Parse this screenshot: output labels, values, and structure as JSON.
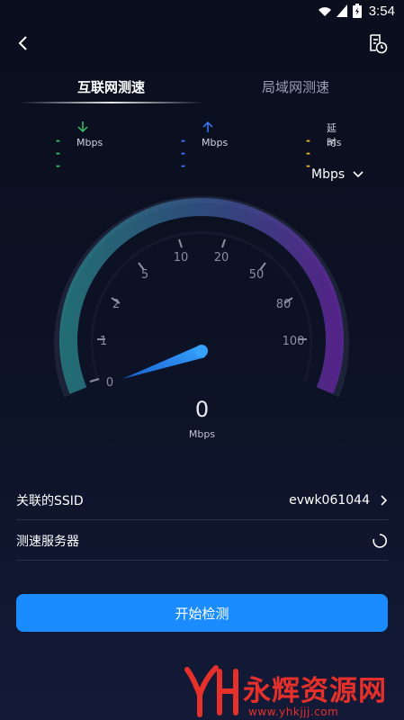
{
  "status": {
    "time": "3:54",
    "battery_level": 0.95
  },
  "tabs": [
    {
      "label": "互联网测速",
      "active": true
    },
    {
      "label": "局域网测速",
      "active": false
    }
  ],
  "metrics": {
    "download": {
      "value": "---",
      "unit": "Mbps",
      "color": "#35c46a",
      "icon": "down-arrow-icon"
    },
    "upload": {
      "value": "---",
      "unit": "Mbps",
      "color": "#3a7bff",
      "icon": "up-arrow-icon"
    },
    "latency": {
      "value": "---",
      "label": "延时",
      "unit": "ms",
      "color": "#f0b82a"
    }
  },
  "unit_selector": {
    "value": "Mbps"
  },
  "gauge": {
    "ticks": [
      "0",
      "1",
      "2",
      "5",
      "10",
      "20",
      "50",
      "80",
      "100"
    ],
    "needle_value": 0,
    "gradient_colors": [
      "#2a8a8e",
      "#4b3a9c",
      "#6a2aa8"
    ]
  },
  "speed": {
    "value": "0",
    "unit": "Mbps"
  },
  "rows": {
    "ssid": {
      "label": "关联的SSID",
      "value": "evwk061044"
    },
    "server": {
      "label": "测速服务器"
    }
  },
  "start_button": {
    "label": "开始检测",
    "color": "#1a8cff"
  },
  "watermark": {
    "text": "永辉资源网",
    "url": "www.yhkjjj.com"
  }
}
